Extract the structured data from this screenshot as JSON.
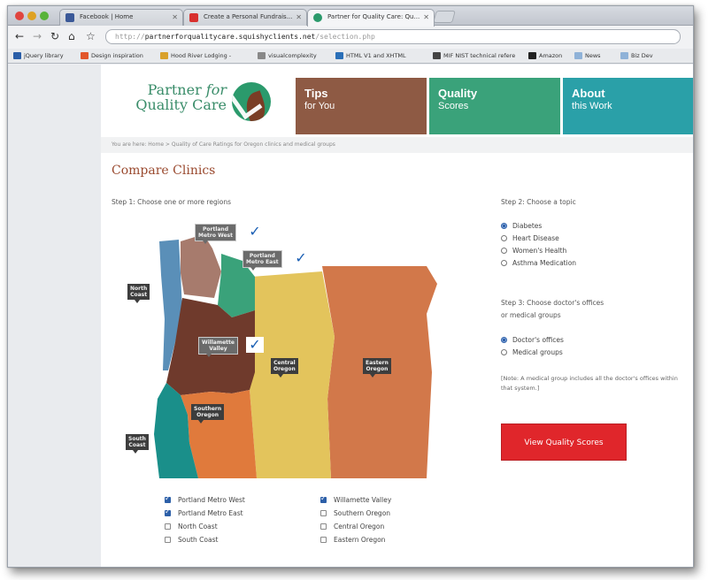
{
  "browser": {
    "tabs": [
      {
        "title": "Facebook | Home"
      },
      {
        "title": "Create a Personal Fundrais..."
      },
      {
        "title": "Partner for Quality Care: Qu..."
      }
    ],
    "url_scheme": "http://",
    "url_host": "partnerforqualitycare.squishyclients.net",
    "url_path": "/selection.php",
    "bookmarks": [
      {
        "label": "jQuery library"
      },
      {
        "label": "Design inspiration"
      },
      {
        "label": "Hood River Lodging -"
      },
      {
        "label": "visualcomplexity"
      },
      {
        "label": "HTML V1 and XHTML"
      },
      {
        "label": "MIF NIST technical refere"
      },
      {
        "label": "Amazon"
      },
      {
        "label": "News"
      },
      {
        "label": "Biz Dev"
      }
    ]
  },
  "site": {
    "logo_line1": "Partner ",
    "logo_for": "for",
    "logo_line2": "Quality Care",
    "nav": [
      {
        "big": "Tips",
        "small": "for You",
        "color": "#8e5a44"
      },
      {
        "big": "Quality",
        "small": "Scores",
        "color": "#3aa27a"
      },
      {
        "big": "About",
        "small": "this Work",
        "color": "#2aa0a8"
      }
    ],
    "breadcrumb": "You are here:  Home  >  Quality of Care Ratings for Oregon clinics and medical groups",
    "title": "Compare Clinics",
    "step1": "Step 1: Choose one or more regions",
    "step2": "Step 2: Choose a topic",
    "topics": [
      {
        "label": "Diabetes",
        "selected": true
      },
      {
        "label": "Heart Disease",
        "selected": false
      },
      {
        "label": "Women's Health",
        "selected": false
      },
      {
        "label": "Asthma Medication",
        "selected": false
      }
    ],
    "step3_line1": "Step 3: Choose doctor's offices",
    "step3_line2": "or medical groups",
    "provider_types": [
      {
        "label": "Doctor's offices",
        "selected": true
      },
      {
        "label": "Medical groups",
        "selected": false
      }
    ],
    "note": "[Note: A medical group includes all the doctor's offices within that system.]",
    "cta": "View Quality Scores",
    "map_labels": {
      "portland_west": [
        "Portland",
        "Metro West"
      ],
      "portland_east": [
        "Portland",
        "Metro East"
      ],
      "north_coast": [
        "North",
        "Coast"
      ],
      "willamette": [
        "Willamette",
        "Valley"
      ],
      "central": [
        "Central",
        "Oregon"
      ],
      "eastern": [
        "Eastern",
        "Oregon"
      ],
      "southern": [
        "Southern",
        "Oregon"
      ],
      "south_coast": [
        "South",
        "Coast"
      ]
    },
    "region_colors": {
      "north_coast": "#5a8fb8",
      "portland_west": "#a77b6d",
      "portland_east": "#3aa27a",
      "willamette": "#6f3a2c",
      "central": "#e3c45c",
      "eastern": "#d2784a",
      "southern": "#e07a3c",
      "south_coast": "#1a8f8a"
    },
    "regions_col1": [
      {
        "label": "Portland Metro West",
        "checked": true
      },
      {
        "label": "Portland Metro East",
        "checked": true
      },
      {
        "label": "North Coast",
        "checked": false
      },
      {
        "label": "South Coast",
        "checked": false
      }
    ],
    "regions_col2": [
      {
        "label": "Willamette Valley",
        "checked": true
      },
      {
        "label": "Southern Oregon",
        "checked": false
      },
      {
        "label": "Central Oregon",
        "checked": false
      },
      {
        "label": "Eastern Oregon",
        "checked": false
      }
    ]
  }
}
